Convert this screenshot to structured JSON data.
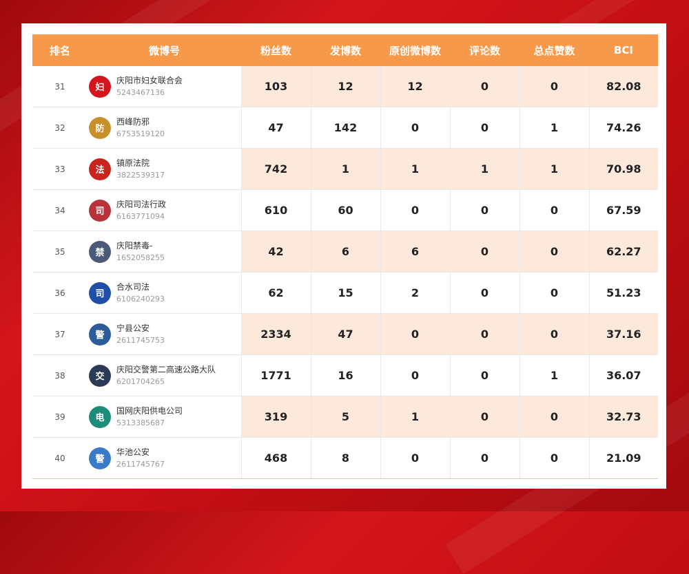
{
  "columns": {
    "rank": "排名",
    "account": "微博号",
    "fans": "粉丝数",
    "posts": "发博数",
    "original": "原创微博数",
    "comments": "评论数",
    "likes": "总点赞数",
    "bci": "BCI"
  },
  "rows": [
    {
      "rank": "31",
      "name": "庆阳市妇女联合会",
      "id": "5243467136",
      "fans": "103",
      "posts": "12",
      "original": "12",
      "comments": "0",
      "likes": "0",
      "bci": "82.08",
      "icon": "women-federation-logo-icon",
      "color": "#d4161c",
      "glyph": "妇"
    },
    {
      "rank": "32",
      "name": "西峰防邪",
      "id": "6753519120",
      "fans": "47",
      "posts": "142",
      "original": "0",
      "comments": "0",
      "likes": "1",
      "bci": "74.26",
      "icon": "anti-cult-emblem-icon",
      "color": "#c8902a",
      "glyph": "防"
    },
    {
      "rank": "33",
      "name": "镇原法院",
      "id": "3822539317",
      "fans": "742",
      "posts": "1",
      "original": "1",
      "comments": "1",
      "likes": "1",
      "bci": "70.98",
      "icon": "court-emblem-icon",
      "color": "#c9241d",
      "glyph": "法"
    },
    {
      "rank": "34",
      "name": "庆阳司法行政",
      "id": "6163771094",
      "fans": "610",
      "posts": "60",
      "original": "0",
      "comments": "0",
      "likes": "0",
      "bci": "67.59",
      "icon": "justice-emblem-icon",
      "color": "#b8323a",
      "glyph": "司"
    },
    {
      "rank": "35",
      "name": "庆阳禁毒-",
      "id": "1652058255",
      "fans": "42",
      "posts": "6",
      "original": "6",
      "comments": "0",
      "likes": "0",
      "bci": "62.27",
      "icon": "anti-drug-emblem-icon",
      "color": "#4a5a78",
      "glyph": "禁"
    },
    {
      "rank": "36",
      "name": "合水司法",
      "id": "6106240293",
      "fans": "62",
      "posts": "15",
      "original": "2",
      "comments": "0",
      "likes": "0",
      "bci": "51.23",
      "icon": "justice-emblem-icon",
      "color": "#1f4fa8",
      "glyph": "司"
    },
    {
      "rank": "37",
      "name": "宁县公安",
      "id": "2611745753",
      "fans": "2334",
      "posts": "47",
      "original": "0",
      "comments": "0",
      "likes": "0",
      "bci": "37.16",
      "icon": "police-badge-icon",
      "color": "#2c5d9a",
      "glyph": "警"
    },
    {
      "rank": "38",
      "name": "庆阳交警第二高速公路大队",
      "id": "6201704265",
      "fans": "1771",
      "posts": "16",
      "original": "0",
      "comments": "0",
      "likes": "1",
      "bci": "36.07",
      "icon": "traffic-police-cartoon-icon",
      "color": "#2b3a55",
      "glyph": "交"
    },
    {
      "rank": "39",
      "name": "国网庆阳供电公司",
      "id": "5313385687",
      "fans": "319",
      "posts": "5",
      "original": "1",
      "comments": "0",
      "likes": "0",
      "bci": "32.73",
      "icon": "state-grid-logo-icon",
      "color": "#1e8c7a",
      "glyph": "电"
    },
    {
      "rank": "40",
      "name": "华池公安",
      "id": "2611745767",
      "fans": "468",
      "posts": "8",
      "original": "0",
      "comments": "0",
      "likes": "0",
      "bci": "21.09",
      "icon": "police-badge-icon",
      "color": "#3a7bc8",
      "glyph": "警"
    }
  ]
}
